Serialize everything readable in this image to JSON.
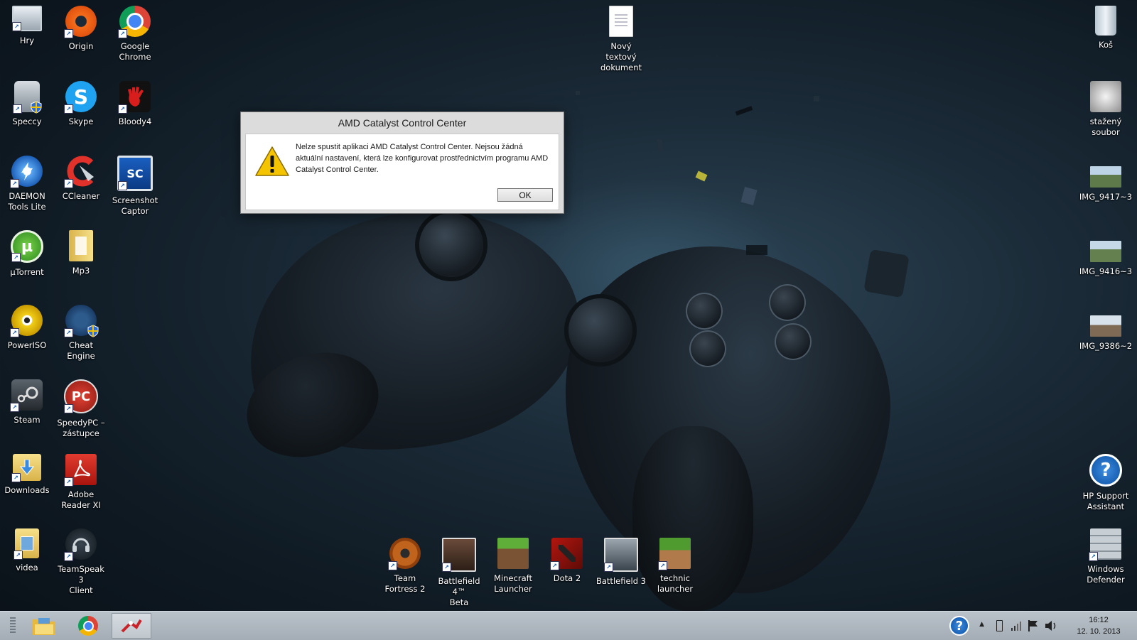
{
  "desktop": {
    "icons": {
      "hry": "Hry",
      "origin": "Origin",
      "chrome_1": "Google",
      "chrome_2": "Chrome",
      "speccy": "Speccy",
      "skype": "Skype",
      "bloody": "Bloody4",
      "daemon_1": "DAEMON",
      "daemon_2": "Tools Lite",
      "ccleaner": "CCleaner",
      "screenshot_1": "Screenshot",
      "screenshot_2": "Captor",
      "utorrent": "µTorrent",
      "mp3": "Mp3",
      "poweriso": "PowerISO",
      "cheatengine": "Cheat Engine",
      "steam": "Steam",
      "speedypc_1": "SpeedyPC –",
      "speedypc_2": "zástupce",
      "downloads": "Downloads",
      "adobe_1": "Adobe",
      "adobe_2": "Reader XI",
      "videa": "videa",
      "teamspeak_1": "TeamSpeak 3",
      "teamspeak_2": "Client",
      "textdoc_1": "Nový textový",
      "textdoc_2": "dokument",
      "tf2_1": "Team",
      "tf2_2": "Fortress 2",
      "bf4_1": "Battlefield 4™",
      "bf4_2": "Beta",
      "minecraft_1": "Minecraft",
      "minecraft_2": "Launcher",
      "dota": "Dota 2",
      "bf3": "Battlefield 3",
      "technic_1": "technic",
      "technic_2": "launcher",
      "kos": "Koš",
      "stazeny_1": "stažený",
      "stazeny_2": "soubor",
      "img1": "IMG_9417~3",
      "img2": "IMG_9416~3",
      "img3": "IMG_9386~2",
      "hp_1": "HP Support",
      "hp_2": "Assistant",
      "defender_1": "Windows",
      "defender_2": "Defender"
    },
    "icon_glyphs": {
      "skype": "S",
      "screenshot": "SC",
      "speedypc": "PC",
      "help": "?"
    }
  },
  "dialog": {
    "title": "AMD Catalyst Control Center",
    "message": "Nelze spustit aplikaci AMD Catalyst Control Center. Nejsou žádná aktuální nastavení, která lze konfigurovat prostřednictvím programu AMD Catalyst Control Center.",
    "ok_label": "OK"
  },
  "taskbar": {
    "time": "16:12",
    "date": "12. 10. 2013",
    "tray_help_glyph": "?",
    "tray_arrow_glyph": "▲"
  },
  "colors": {
    "warning_yellow": "#f5c400",
    "taskbar": "#a9b2ba"
  }
}
